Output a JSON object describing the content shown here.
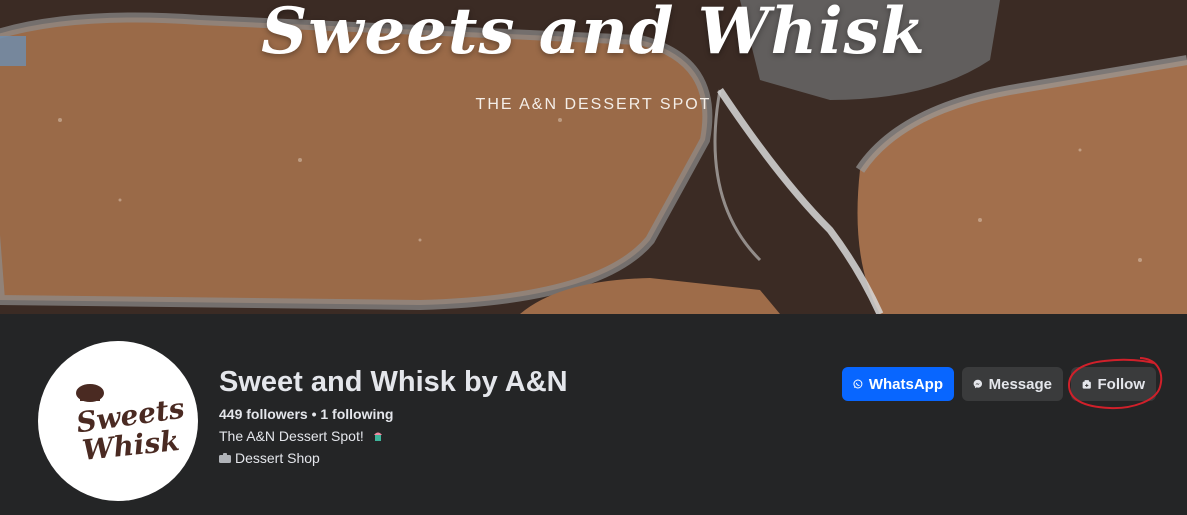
{
  "cover": {
    "title": "Sweets and Whisk",
    "subtitle": "THE A&N DESSERT SPOT"
  },
  "avatar": {
    "line1": "Sweets",
    "line2": "Whisk"
  },
  "page": {
    "name": "Sweet and Whisk by A&N",
    "follow_stats": "449 followers • 1 following",
    "bio": "The A&N Dessert Spot!",
    "category": "Dessert Shop"
  },
  "actions": {
    "whatsapp_label": "WhatsApp",
    "message_label": "Message",
    "follow_label": "Follow"
  },
  "colors": {
    "background": "#242526",
    "primary_button": "#0866ff",
    "secondary_button": "#3a3b3c",
    "annotation_circle": "#d0202a"
  },
  "icons": {
    "whatsapp": "whatsapp-icon",
    "message": "messenger-icon",
    "follow": "follow-page-icon",
    "category": "category-icon",
    "bio_emoji": "cupcake-emoji"
  }
}
